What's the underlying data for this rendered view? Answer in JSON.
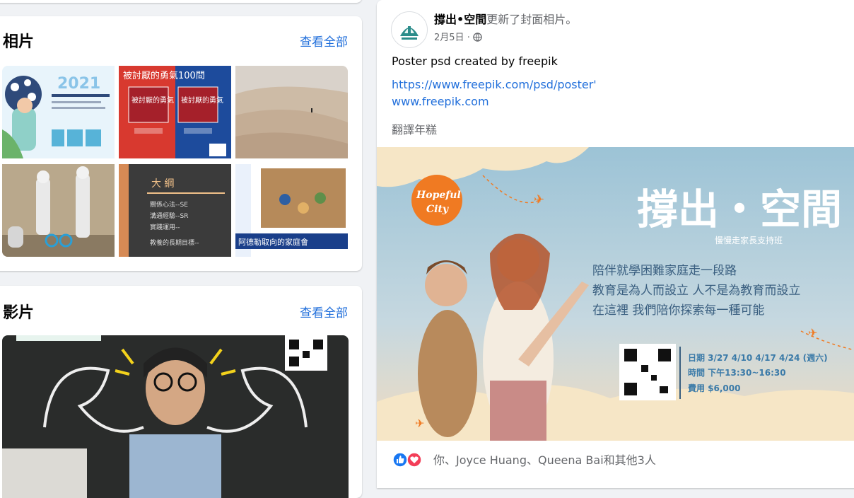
{
  "photos": {
    "title": "相片",
    "see_all": "查看全部",
    "items": [
      {
        "caption_year": "2021"
      },
      {
        "caption_title": "被討厭的勇氣100問",
        "book_a": "被討厭的勇氣",
        "book_b": "被討厭的勇氣"
      },
      {},
      {},
      {
        "outline_title": "大  綱",
        "outline_items": [
          "關係心法--SE",
          "溝通經驗--SR",
          "實踐運用--",
          "教養的長期目標--"
        ]
      },
      {
        "bottom_caption": "阿德勒取向的家庭會"
      }
    ]
  },
  "videos": {
    "title": "影片",
    "see_all": "查看全部"
  },
  "post": {
    "page_name": "撐出•空間",
    "action_text": "更新了封面相片。",
    "date": "2月5日",
    "privacy_icon": "globe-icon",
    "text": "Poster psd created by freepik",
    "link_line1": "https://www.freepik.com/psd/poster'",
    "link_line2": "www.freepik.com",
    "translate": "翻譯年糕",
    "banner": {
      "logo_line1": "Hopeful",
      "logo_line2": "City",
      "title": "撐出・空間",
      "subtitle": "慢慢走家長支持班",
      "line1": "陪伴就學困難家庭走一段路",
      "line2": "教育是為人而設立 人不是為教育而設立",
      "line3": "在這裡 我們陪你探索每一種可能",
      "date_line": "日期 3/27  4/10  4/17  4/24 (週六)",
      "time_line": "時間 下午13:30~16:30",
      "fee_line": "費用 $6,000"
    },
    "reactions": {
      "icons": [
        "like-icon",
        "love-icon"
      ],
      "names": "你、Joyce Huang、Queena Bai和其他3人"
    }
  },
  "colors": {
    "link": "#216fdb",
    "muted": "#65676b",
    "like": "#1877f2",
    "love": "#f33e58",
    "banner_orange": "#f07a22"
  }
}
